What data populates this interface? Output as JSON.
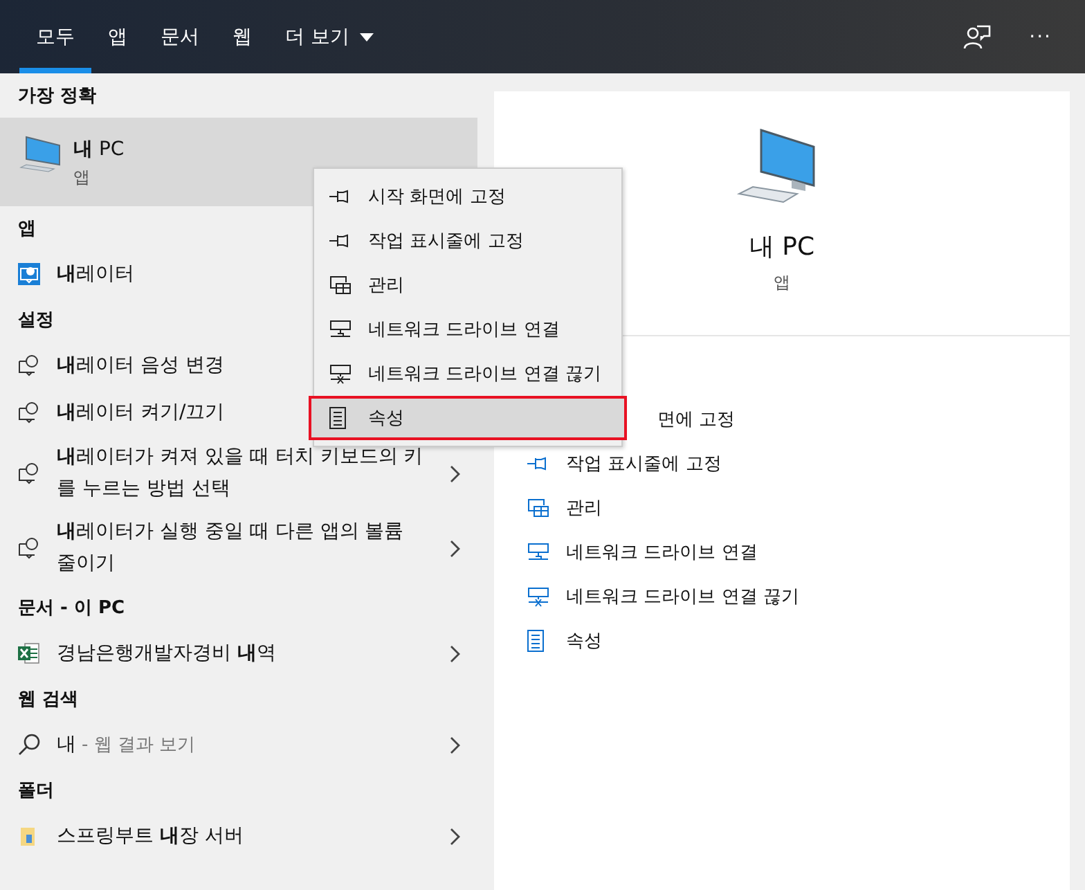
{
  "tabs": [
    {
      "label": "모두",
      "selected": true
    },
    {
      "label": "앱",
      "selected": false
    },
    {
      "label": "문서",
      "selected": false
    },
    {
      "label": "웹",
      "selected": false
    },
    {
      "label": "더 보기",
      "selected": false,
      "kind": "dropdown"
    }
  ],
  "toolbar": {
    "more": "···"
  },
  "results": [
    {
      "header": "가장 정확",
      "items": [
        {
          "kind": "pc",
          "title": "**내** PC",
          "subtitle": "앱",
          "selected": true,
          "arrow": false
        }
      ]
    },
    {
      "header": "앱",
      "items": [
        {
          "kind": "narrator",
          "title": "**내**레이터",
          "selected": false,
          "arrow": false
        }
      ]
    },
    {
      "header": "설정",
      "items": [
        {
          "kind": "setting",
          "title": "**내**레이터 음성 변경",
          "selected": false,
          "arrow": false
        },
        {
          "kind": "setting",
          "title": "**내**레이터 켜기/끄기",
          "selected": false,
          "arrow": false
        },
        {
          "kind": "setting",
          "title": "**내**레이터가 켜져 있을 때 터치 키보드의 키를 누르는 방법 선택",
          "selected": false,
          "arrow": true
        },
        {
          "kind": "setting",
          "title": "**내**레이터가 실행 중일 때 다른 앱의 볼륨 줄이기",
          "selected": false,
          "arrow": true
        }
      ]
    },
    {
      "header": "문서 - 이 PC",
      "items": [
        {
          "kind": "excel",
          "title": "경남은행개발자경비 **내**역",
          "selected": false,
          "arrow": true
        }
      ]
    },
    {
      "header": "웹 검색",
      "items": [
        {
          "kind": "search",
          "title": "내",
          "hint": "- 웹 결과 보기",
          "selected": false,
          "arrow": true
        }
      ]
    },
    {
      "header": "폴더",
      "items": [
        {
          "kind": "folder",
          "title": "스프링부트 **내**장 서버",
          "selected": false,
          "arrow": true
        }
      ]
    }
  ],
  "preview": {
    "title": "내 PC",
    "subtitle": "앱",
    "actions": [
      {
        "label": "면에 고정"
      },
      {
        "kind": "pin",
        "label": "작업 표시줄에 고정"
      },
      {
        "kind": "manage",
        "label": "관리"
      },
      {
        "kind": "map-drive",
        "label": "네트워크 드라이브 연결"
      },
      {
        "kind": "disconnect-drive",
        "label": "네트워크 드라이브 연결 끊기"
      },
      {
        "kind": "properties",
        "label": "속성"
      }
    ]
  },
  "context_menu": [
    {
      "kind": "pin",
      "label": "시작 화면에 고정",
      "selected": false
    },
    {
      "kind": "pin",
      "label": "작업 표시줄에 고정",
      "selected": false
    },
    {
      "kind": "manage",
      "label": "관리",
      "selected": false
    },
    {
      "kind": "map-drive",
      "label": "네트워크 드라이브 연결",
      "selected": false
    },
    {
      "kind": "disconnect-drive",
      "label": "네트워크 드라이브 연결 끊기",
      "selected": false
    },
    {
      "kind": "properties",
      "label": "속성",
      "selected": true
    }
  ]
}
